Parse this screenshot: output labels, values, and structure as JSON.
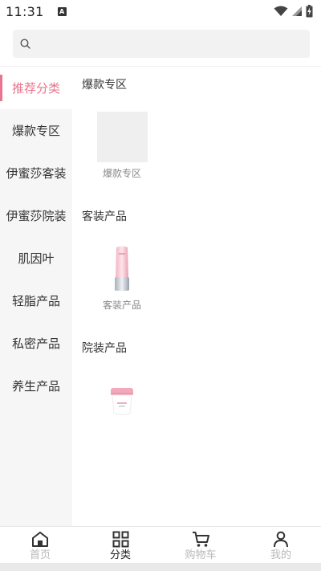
{
  "status_bar": {
    "time": "11:31",
    "notification_letter": "A"
  },
  "search": {
    "placeholder": ""
  },
  "sidebar": {
    "items": [
      {
        "label": "推荐分类",
        "active": true
      },
      {
        "label": "爆款专区",
        "active": false
      },
      {
        "label": "伊蜜莎客装",
        "active": false
      },
      {
        "label": "伊蜜莎院装",
        "active": false
      },
      {
        "label": "肌因叶",
        "active": false
      },
      {
        "label": "轻脂产品",
        "active": false
      },
      {
        "label": "私密产品",
        "active": false
      },
      {
        "label": "养生产品",
        "active": false
      }
    ]
  },
  "sections": [
    {
      "title": "爆款专区",
      "products": [
        {
          "label": "爆款专区",
          "icon": "image-placeholder"
        }
      ]
    },
    {
      "title": "客装产品",
      "products": [
        {
          "label": "客装产品",
          "icon": "pink-bottle-product"
        }
      ]
    },
    {
      "title": "院装产品",
      "products": [
        {
          "label": "",
          "icon": "pink-jar-product"
        }
      ]
    }
  ],
  "tabbar": {
    "items": [
      {
        "label": "首页",
        "icon": "home-icon",
        "active": false
      },
      {
        "label": "分类",
        "icon": "category-grid-icon",
        "active": true
      },
      {
        "label": "购物车",
        "icon": "cart-icon",
        "active": false
      },
      {
        "label": "我的",
        "icon": "user-icon",
        "active": false
      }
    ]
  },
  "colors": {
    "accent": "#e8748e",
    "sidebar_bg": "#f6f6f6",
    "search_bg": "#f2f2f2"
  }
}
